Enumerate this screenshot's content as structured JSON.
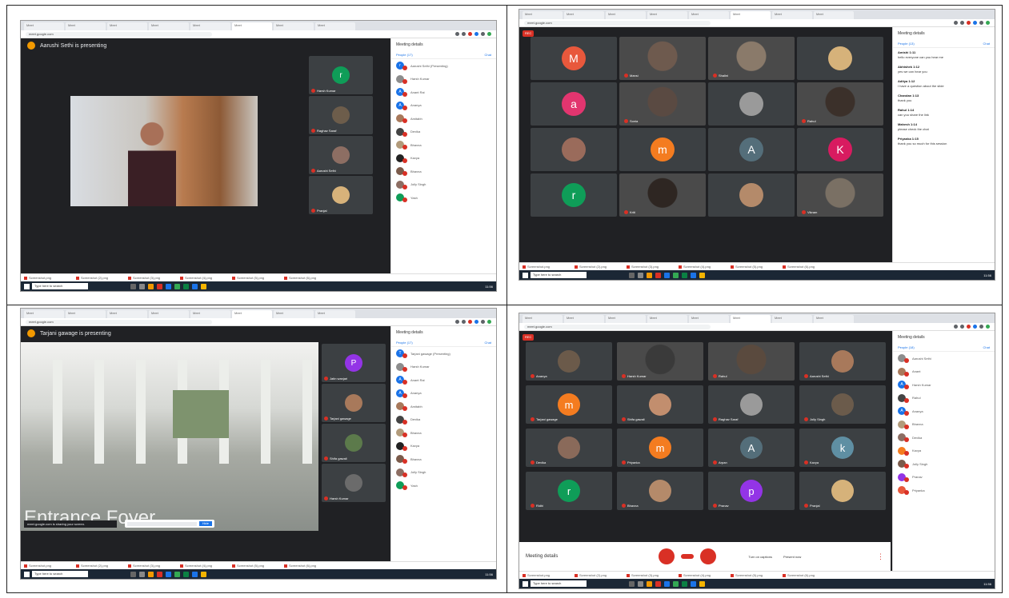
{
  "browser": {
    "tab_label": "Meet",
    "url": "meet.google.com"
  },
  "screens": {
    "s1": {
      "presenting_label": "Aarushi Sethi is presenting",
      "sidebar_title": "Meeting details",
      "people_tab": "People (17)",
      "chat_tab": "Chat",
      "filmstrip": [
        {
          "name": "Harsh Kumar",
          "initial": "r",
          "color": "#0f9d58"
        },
        {
          "name": "Raghav Saraf",
          "initial": "",
          "color": "#6d5d4b"
        },
        {
          "name": "Aarushi Sethi",
          "initial": "",
          "color": "#8d6e63"
        },
        {
          "name": "Pranjal",
          "initial": "",
          "color": "#d7b27a"
        }
      ],
      "people": [
        {
          "initial": "r",
          "color": "#1a73e8",
          "name": "Aarushi Sethi (Presenting)"
        },
        {
          "initial": "",
          "color": "#8d8d8d",
          "name": "Harsh Kumar"
        },
        {
          "initial": "A",
          "color": "#1a73e8",
          "name": "Anant Rai"
        },
        {
          "initial": "A",
          "color": "#1a73e8",
          "name": "Ananya"
        },
        {
          "initial": "",
          "color": "#a8795b",
          "name": "Amitabh"
        },
        {
          "initial": "",
          "color": "#444",
          "name": "Devika"
        },
        {
          "initial": "",
          "color": "#b29b7b",
          "name": "Bhavna"
        },
        {
          "initial": "",
          "color": "#222",
          "name": "Kavya"
        },
        {
          "initial": "",
          "color": "#7b5b4b",
          "name": "Bhavna"
        },
        {
          "initial": "",
          "color": "#8d6e63",
          "name": "Jolly Singh"
        },
        {
          "initial": "",
          "color": "#0f9d58",
          "name": "Yash"
        }
      ]
    },
    "s2": {
      "rec_label": "REC",
      "sidebar_title": "Meeting details",
      "people_tab": "People (13)",
      "chat_tab": "Chat",
      "tiles": [
        {
          "type": "avatar",
          "initial": "M",
          "color": "#e8583c"
        },
        {
          "type": "video",
          "name": "Mansi",
          "color": "#6e5a4e"
        },
        {
          "type": "video",
          "name": "Shalini",
          "color": "#8a7a6a"
        },
        {
          "type": "photo",
          "color": "#d6b27a"
        },
        {
          "type": "avatar",
          "initial": "a",
          "color": "#e2356f"
        },
        {
          "type": "video",
          "name": "Sonia",
          "color": "#5a4a42"
        },
        {
          "type": "photo",
          "color": "#9a9a9a"
        },
        {
          "type": "video",
          "name": "Rahul",
          "color": "#3b302a"
        },
        {
          "type": "photo",
          "color": "#9a6b5b"
        },
        {
          "type": "avatar",
          "initial": "m",
          "color": "#f47c20"
        },
        {
          "type": "avatar",
          "initial": "A",
          "color": "#546e7a"
        },
        {
          "type": "avatar",
          "initial": "K",
          "color": "#d81b60"
        },
        {
          "type": "avatar",
          "initial": "r",
          "color": "#0f9d58"
        },
        {
          "type": "video",
          "name": "Kriti",
          "color": "#2e2622"
        },
        {
          "type": "photo",
          "color": "#b48a6a"
        },
        {
          "type": "video",
          "name": "Vikram",
          "color": "#7a7064"
        }
      ],
      "chat": [
        {
          "who": "Amishi 1:11",
          "text": "hello everyone can you hear me"
        },
        {
          "who": "Abhishek 1:12",
          "text": "yes we can hear you"
        },
        {
          "who": "Aditya 1:12",
          "text": "I have a question about the slide"
        },
        {
          "who": "Chandan 1:13",
          "text": "thank you"
        },
        {
          "who": "Rahul 1:14",
          "text": "can you share the link"
        },
        {
          "who": "Mahesh 1:14",
          "text": "please check the chat"
        },
        {
          "who": "Priyanka 1:15",
          "text": "thank you so much for this session"
        }
      ]
    },
    "s3": {
      "presenting_label": "Tarjani gawage is presenting",
      "sidebar_title": "Meeting details",
      "people_tab": "People (17)",
      "chat_tab": "Chat",
      "banner_text": "Entrance Foyer",
      "toast_text": "meet.google.com is sharing your screen.",
      "toast_button": "Hide",
      "filmstrip": [
        {
          "name": "Jatin wanjari",
          "initial": "P",
          "color": "#9334e6"
        },
        {
          "name": "Tarjani gawage",
          "initial": "",
          "color": "#a8795b"
        },
        {
          "name": "Shifa gawali",
          "initial": "",
          "color": "#5c7a4b"
        },
        {
          "name": "Harsh Kumar",
          "initial": "",
          "color": "#6b6b6b"
        }
      ],
      "people": [
        {
          "initial": "T",
          "color": "#1a73e8",
          "name": "Tarjani gawage (Presenting)"
        },
        {
          "initial": "",
          "color": "#8d8d8d",
          "name": "Harsh Kumar"
        },
        {
          "initial": "A",
          "color": "#1a73e8",
          "name": "Anant Rai"
        },
        {
          "initial": "A",
          "color": "#1a73e8",
          "name": "Ananya"
        },
        {
          "initial": "",
          "color": "#a8795b",
          "name": "Amitabh"
        },
        {
          "initial": "",
          "color": "#444",
          "name": "Devika"
        },
        {
          "initial": "",
          "color": "#b29b7b",
          "name": "Bhavna"
        },
        {
          "initial": "",
          "color": "#222",
          "name": "Kavya"
        },
        {
          "initial": "",
          "color": "#7b5b4b",
          "name": "Bhavna"
        },
        {
          "initial": "",
          "color": "#8d6e63",
          "name": "Jolly Singh"
        },
        {
          "initial": "",
          "color": "#0f9d58",
          "name": "Yash"
        }
      ]
    },
    "s4": {
      "rec_label": "REC",
      "sidebar_title": "Meeting details",
      "people_tab": "People (18)",
      "chat_tab": "Chat",
      "meeting_details": "Meeting details",
      "present_label": "Turn on captions",
      "present_now": "Present now",
      "tiles": [
        {
          "type": "photo",
          "name": "Ananya",
          "color": "#6b5a4a"
        },
        {
          "type": "video",
          "name": "Harsh Kumar",
          "color": "#3a3a3a"
        },
        {
          "type": "video",
          "name": "Rahul",
          "color": "#5a4a3e"
        },
        {
          "type": "photo",
          "name": "Aarushi Sethi",
          "color": "#a8795b"
        },
        {
          "type": "avatar",
          "name": "Tarjani gawage",
          "initial": "m",
          "color": "#f47c20"
        },
        {
          "type": "photo",
          "name": "Shifa gawali",
          "color": "#c28e6e"
        },
        {
          "type": "photo",
          "name": "Raghav Saraf",
          "color": "#9a9a9a"
        },
        {
          "type": "photo",
          "name": "Jolly Singh",
          "color": "#6b5b4b"
        },
        {
          "type": "photo",
          "name": "Devika",
          "color": "#8a6a5a"
        },
        {
          "type": "avatar",
          "name": "Priyanka",
          "initial": "m",
          "color": "#f47c20"
        },
        {
          "type": "avatar",
          "name": "Arpan",
          "initial": "A",
          "color": "#546e7a"
        },
        {
          "type": "avatar",
          "name": "Kavya",
          "initial": "k",
          "color": "#5f8fa3"
        },
        {
          "type": "avatar",
          "name": "Ridhi",
          "initial": "r",
          "color": "#0f9d58"
        },
        {
          "type": "photo",
          "name": "Bhavna",
          "color": "#b48a6a"
        },
        {
          "type": "avatar",
          "name": "Pranav",
          "initial": "p",
          "color": "#9334e6"
        },
        {
          "type": "photo",
          "name": "Pranjal",
          "color": "#d6b27a"
        }
      ],
      "people": [
        {
          "initial": "",
          "color": "#8d8d8d",
          "name": "Aarushi Sethi"
        },
        {
          "initial": "",
          "color": "#a8795b",
          "name": "Anant"
        },
        {
          "initial": "A",
          "color": "#1a73e8",
          "name": "Harsh Kumar"
        },
        {
          "initial": "",
          "color": "#444",
          "name": "Rahul"
        },
        {
          "initial": "A",
          "color": "#1a73e8",
          "name": "Ananya"
        },
        {
          "initial": "",
          "color": "#b29b7b",
          "name": "Bhavna"
        },
        {
          "initial": "",
          "color": "#8d6e63",
          "name": "Devika"
        },
        {
          "initial": "",
          "color": "#f47c20",
          "name": "Kavya"
        },
        {
          "initial": "",
          "color": "#7b5b4b",
          "name": "Jolly Singh"
        },
        {
          "initial": "",
          "color": "#9334e6",
          "name": "Pranav"
        },
        {
          "initial": "",
          "color": "#e8583c",
          "name": "Priyanka"
        }
      ]
    }
  },
  "downloads": [
    "Screenshot.png",
    "Screenshot (2).png",
    "Screenshot (3).png",
    "Screenshot (4).png",
    "Screenshot (5).png",
    "Screenshot (6).png"
  ],
  "taskbar": {
    "search": "Type here to search",
    "time": "11:56"
  }
}
